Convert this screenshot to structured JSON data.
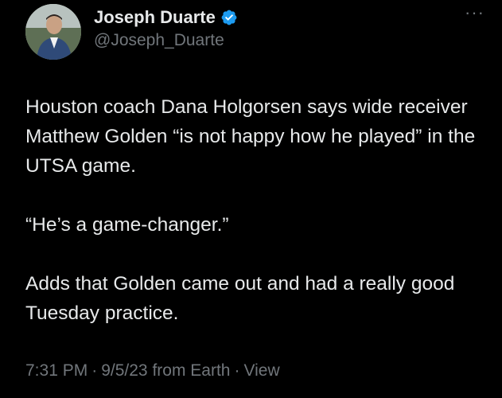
{
  "author": {
    "display_name": "Joseph Duarte",
    "handle": "@Joseph_Duarte",
    "verified": true,
    "avatar_icon": "profile-photo"
  },
  "more_icon": "more-horizontal-icon",
  "tweet": {
    "paragraphs": [
      "Houston coach Dana Holgorsen says wide receiver Matthew Golden “is not happy how he played” in the UTSA game.",
      "“He’s a game-changer.”",
      "Adds that Golden came out and had a really good Tuesday practice."
    ]
  },
  "meta": {
    "time": "7:31 PM",
    "separator": "·",
    "date": "9/5/23",
    "source": "from Earth",
    "view_label": "View"
  },
  "colors": {
    "background": "#000000",
    "primary_text": "#e7e9ea",
    "secondary_text": "#71767b",
    "verified_blue": "#1d9bf0"
  }
}
